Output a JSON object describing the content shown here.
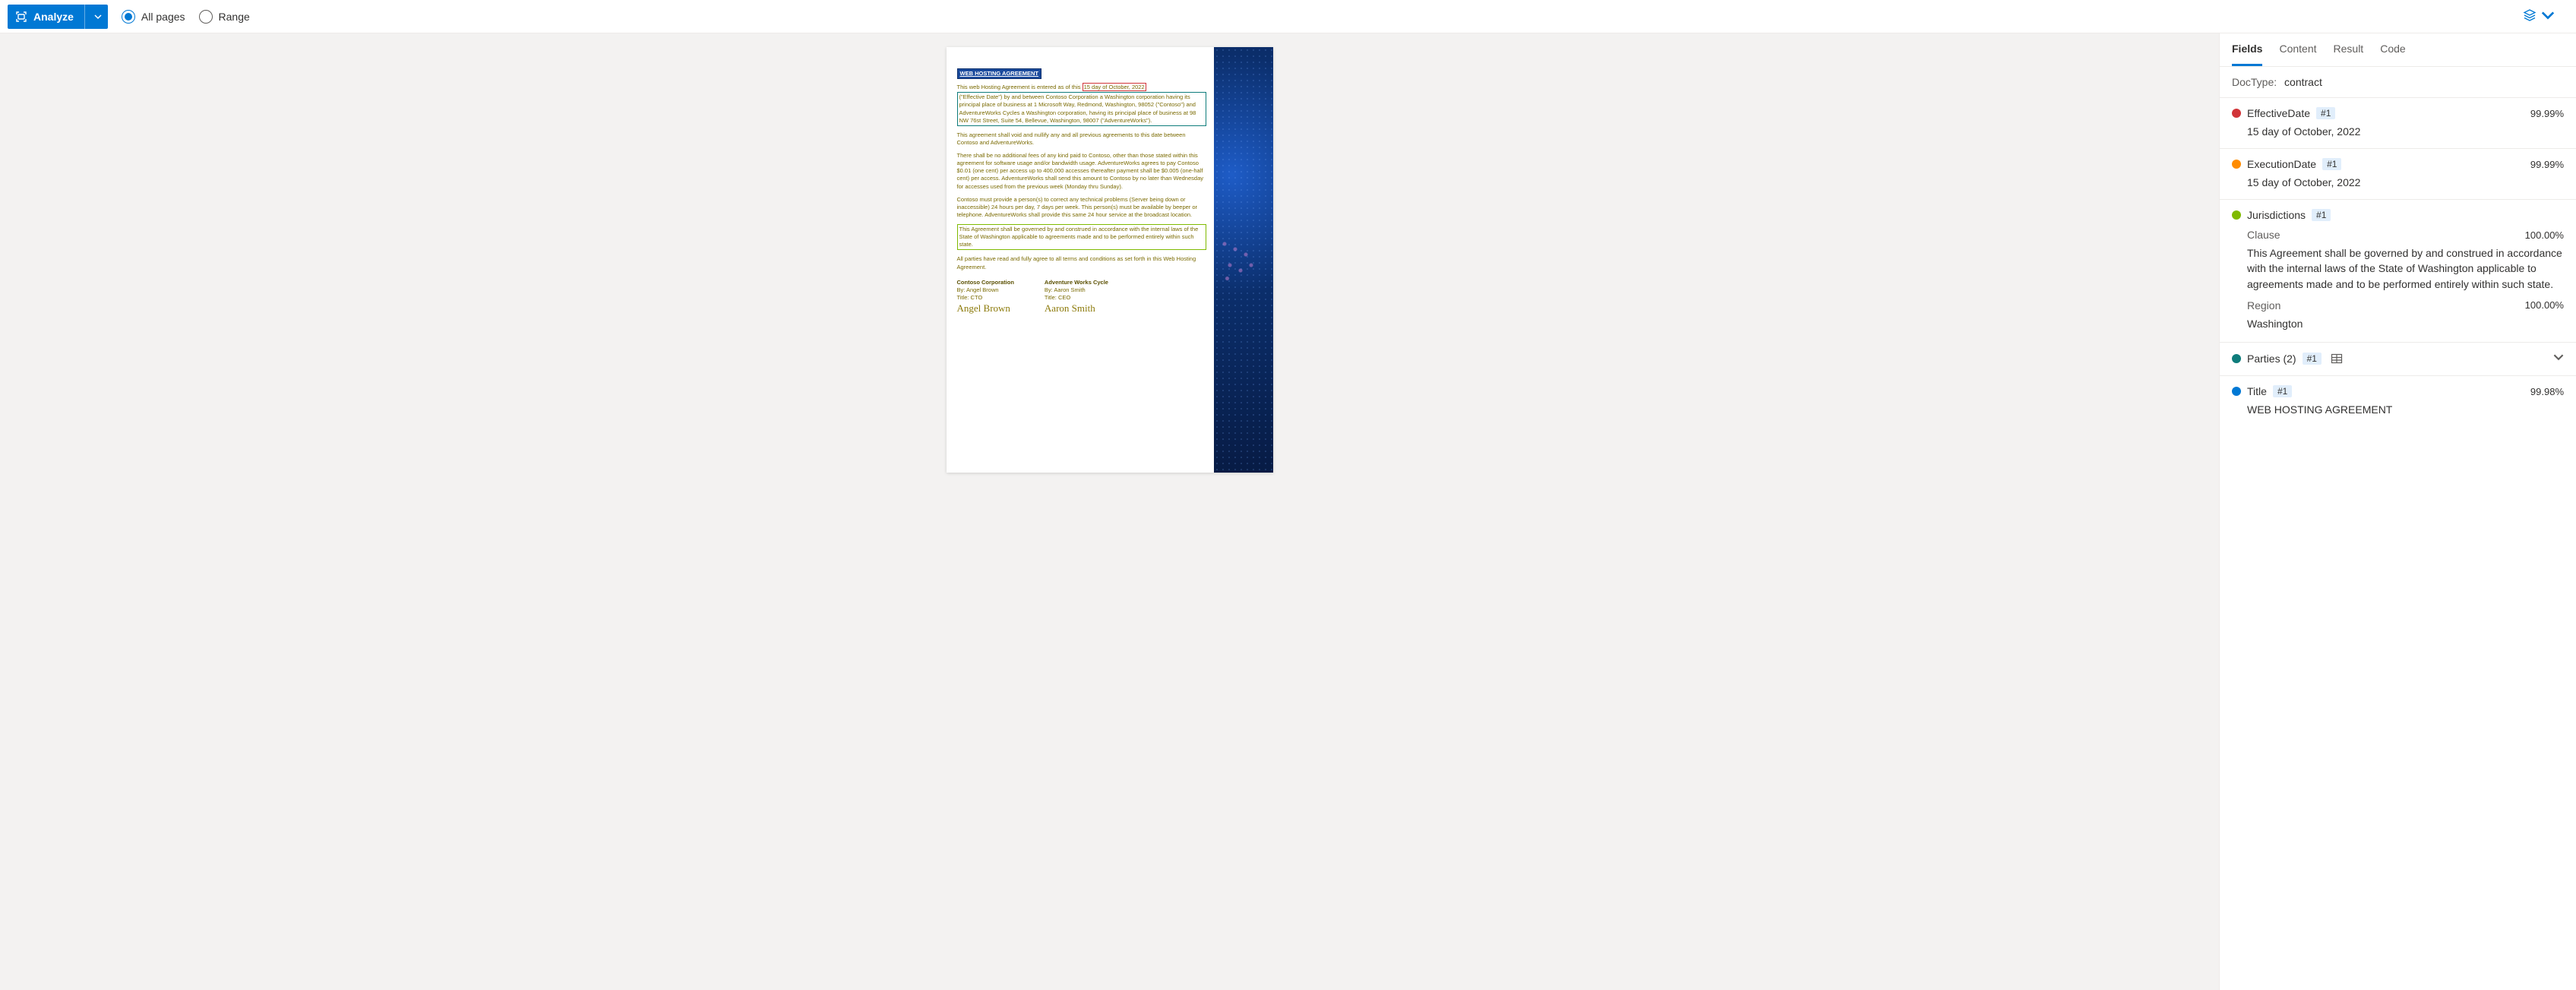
{
  "toolbar": {
    "analyze_label": "Analyze",
    "radio_all": "All pages",
    "radio_range": "Range",
    "radio_selected": "all"
  },
  "tabs": {
    "items": [
      "Fields",
      "Content",
      "Result",
      "Code"
    ],
    "active": 0
  },
  "doctype": {
    "label": "DocType:",
    "value": "contract"
  },
  "fields": [
    {
      "color": "#d13438",
      "name": "EffectiveDate",
      "badge": "#1",
      "confidence": "99.99%",
      "value": "15 day of October, 2022"
    },
    {
      "color": "#ff8c00",
      "name": "ExecutionDate",
      "badge": "#1",
      "confidence": "99.99%",
      "value": "15 day of October, 2022"
    },
    {
      "color": "#7fba00",
      "name": "Jurisdictions",
      "badge": "#1",
      "subfields": [
        {
          "label": "Clause",
          "confidence": "100.00%",
          "value": "This Agreement shall be governed by and construed in accordance with the internal laws of the State of Washington applicable to agreements made and to be performed entirely within such state."
        },
        {
          "label": "Region",
          "confidence": "100.00%",
          "value": "Washington"
        }
      ]
    },
    {
      "color": "#0e7c7b",
      "name": "Parties (2)",
      "badge": "#1",
      "expandable": true
    },
    {
      "color": "#0078d4",
      "name": "Title",
      "badge": "#1",
      "confidence": "99.98%",
      "value": "WEB HOSTING AGREEMENT"
    }
  ],
  "document": {
    "title": "WEB HOSTING AGREEMENT",
    "intro_prefix": "This web Hosting Agreement is entered as of this ",
    "effective_date": "15 day of October, 2022",
    "party_block": "(\"Effective Date\") by and between Contoso Corporation a Washington corporation having its principal place of business at 1 Microsoft Way, Redmond, Washington, 98052 (\"Contoso\") and AdventureWorks Cycles a Washington corporation, having its principal place of business at 98 NW 76st Street, Suite 54, Bellevue, Washington, 98007 (\"AdventureWorks\").",
    "p2": "This agreement shall void and nullify any and all previous agreements to this date between Contoso and AdventureWorks.",
    "p3": "There shall be no additional fees of any kind paid to Contoso, other than those stated within this agreement for software usage and/or bandwidth usage. AdventureWorks agrees to pay Contoso $0.01 (one cent) per access up to 400,000 accesses thereafter payment shall be $0.005 (one-half cent) per access. AdventureWorks shall send this amount to Contoso by no later than Wednesday for accesses used from the previous week (Monday thru Sunday).",
    "p4": "Contoso must provide a person(s) to correct any technical problems (Server being down or inaccessible) 24 hours per day, 7 days per week. This person(s) must be available by beeper or telephone. AdventureWorks shall provide this same 24 hour service at the broadcast location.",
    "jurisdiction": "This Agreement shall be governed by and construed in accordance with the internal laws of the State of Washington applicable to agreements made and to be performed entirely within such state.",
    "p6": "All parties have read and fully agree to all terms and conditions as set forth in this Web Hosting Agreement.",
    "sig1": {
      "company": "Contoso Corporation",
      "by": "By: Angel Brown",
      "title": "Title: CTO",
      "sig": "Angel Brown"
    },
    "sig2": {
      "company": "Adventure Works Cycle",
      "by": "By: Aaron Smith",
      "title": "Title: CEO",
      "sig": "Aaron Smith"
    }
  }
}
